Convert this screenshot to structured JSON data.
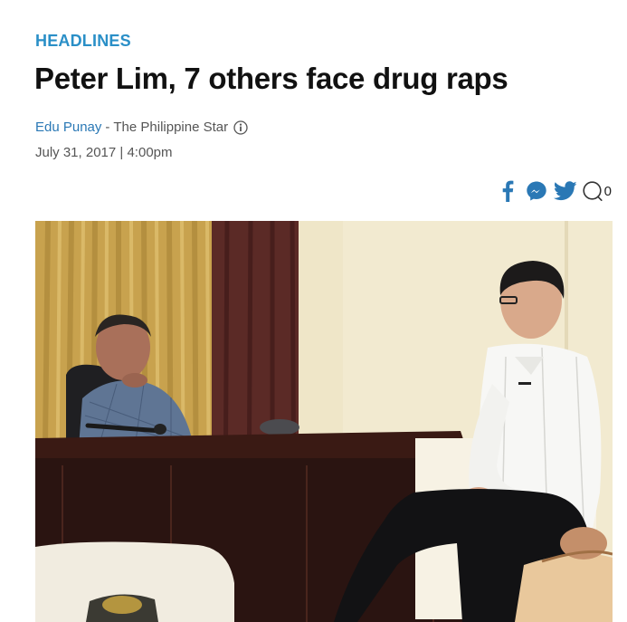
{
  "article": {
    "section": "HEADLINES",
    "title": "Peter Lim, 7 others face drug raps",
    "author": "Edu Punay",
    "byline_separator": "-",
    "publication": "The Philippine Star",
    "date": "July 31, 2017 | 4:00pm"
  },
  "share": {
    "icons": [
      "facebook-icon",
      "messenger-icon",
      "twitter-icon",
      "comment-icon"
    ],
    "comment_count": "0",
    "accent_color": "#2a78b5"
  },
  "colors": {
    "section_label": "#2a8fc7",
    "author_link": "#2a78b5",
    "headline": "#111111"
  }
}
